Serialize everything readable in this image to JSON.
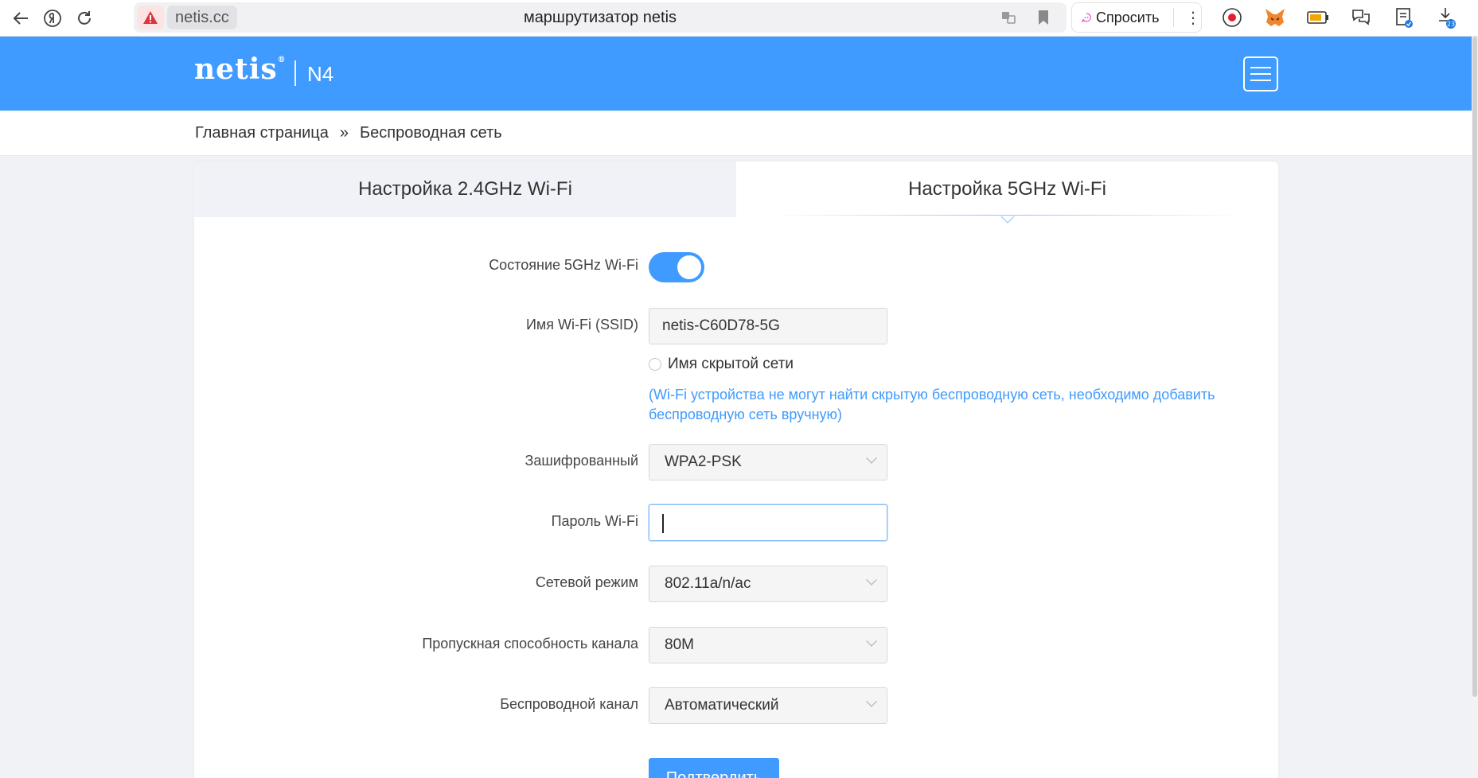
{
  "browser": {
    "url": "netis.cc",
    "page_title": "маршрутизатор netis",
    "ask_label": "Спросить",
    "download_badge": "23"
  },
  "header": {
    "logo": "netis",
    "logo_mark": "®",
    "model": "N4"
  },
  "breadcrumb": {
    "home": "Главная страница",
    "separator": "»",
    "current": "Беспроводная сеть"
  },
  "tabs": [
    {
      "label": "Настройка 2.4GHz Wi-Fi",
      "active": false
    },
    {
      "label": "Настройка 5GHz Wi-Fi",
      "active": true
    }
  ],
  "form": {
    "state_label": "Состояние 5GHz Wi-Fi",
    "state_enabled": true,
    "ssid_label": "Имя Wi-Fi (SSID)",
    "ssid_value": "netis-C60D78-5G",
    "hidden_label": "Имя скрытой сети",
    "hidden_checked": false,
    "hint": "(Wi-Fi устройства не могут найти скрытую беспроводную сеть, необходимо добавить беспроводную сеть вручную)",
    "encryption_label": "Зашифрованный",
    "encryption_value": "WPA2-PSK",
    "password_label": "Пароль Wi-Fi",
    "password_value": "",
    "mode_label": "Сетевой режим",
    "mode_value": "802.11a/n/ac",
    "bandwidth_label": "Пропускная способность канала",
    "bandwidth_value": "80M",
    "channel_label": "Беспроводной канал",
    "channel_value": "Автоматический",
    "submit_label": "Подтвердить"
  },
  "colors": {
    "primary": "#3f9bff",
    "tab_inactive_bg": "#f1f2f8"
  }
}
